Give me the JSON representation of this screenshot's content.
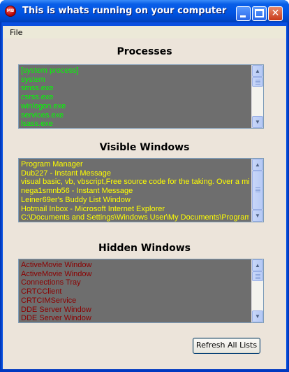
{
  "window": {
    "title": "This is whats running on your computer",
    "icon_text": "MB",
    "close_glyph": "✕"
  },
  "menu": {
    "file": "File"
  },
  "processes": {
    "title": "Processes",
    "color": "#00ff00",
    "items": [
      "[system process]",
      "system",
      "smss.exe",
      "csrss.exe",
      "winlogon.exe",
      "services.exe",
      "lsass.exe"
    ]
  },
  "visible_windows": {
    "title": "Visible Windows",
    "color": "#ffff00",
    "items": [
      "Program Manager",
      "Dub227 - Instant Message",
      "visual basic, vb, vbscript,Free source code for the taking. Over a millio",
      "nega1smnb56 - Instant Message",
      "Leiner69er's Buddy List Window",
      "Hotmail Inbox - Microsoft Internet Explorer",
      "C:\\Documents and Settings\\Windows User\\My Documents\\Programm"
    ]
  },
  "hidden_windows": {
    "title": "Hidden Windows",
    "color": "#8b0000",
    "items": [
      "ActiveMovie Window",
      "ActiveMovie Window",
      "Connections Tray",
      "CRTCClient",
      "CRTCIMService",
      "DDE Server Window",
      "DDE Server Window"
    ]
  },
  "refresh_button": "Refresh All Lists"
}
